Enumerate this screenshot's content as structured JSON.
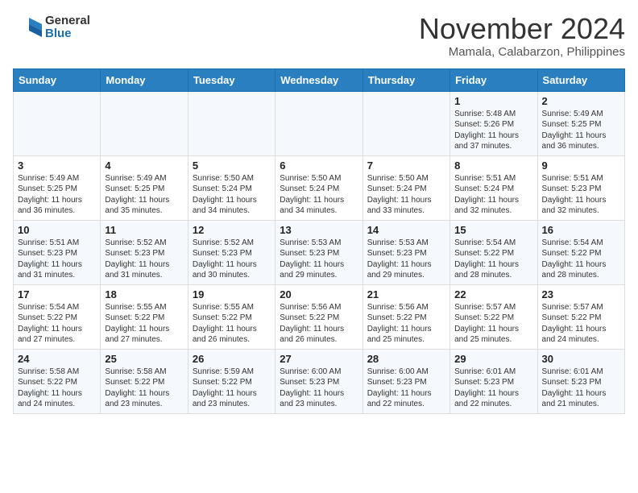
{
  "header": {
    "logo_general": "General",
    "logo_blue": "Blue",
    "month_title": "November 2024",
    "location": "Mamala, Calabarzon, Philippines"
  },
  "calendar": {
    "columns": [
      "Sunday",
      "Monday",
      "Tuesday",
      "Wednesday",
      "Thursday",
      "Friday",
      "Saturday"
    ],
    "rows": [
      [
        {
          "day": "",
          "info": ""
        },
        {
          "day": "",
          "info": ""
        },
        {
          "day": "",
          "info": ""
        },
        {
          "day": "",
          "info": ""
        },
        {
          "day": "",
          "info": ""
        },
        {
          "day": "1",
          "info": "Sunrise: 5:48 AM\nSunset: 5:26 PM\nDaylight: 11 hours\nand 37 minutes."
        },
        {
          "day": "2",
          "info": "Sunrise: 5:49 AM\nSunset: 5:25 PM\nDaylight: 11 hours\nand 36 minutes."
        }
      ],
      [
        {
          "day": "3",
          "info": "Sunrise: 5:49 AM\nSunset: 5:25 PM\nDaylight: 11 hours\nand 36 minutes."
        },
        {
          "day": "4",
          "info": "Sunrise: 5:49 AM\nSunset: 5:25 PM\nDaylight: 11 hours\nand 35 minutes."
        },
        {
          "day": "5",
          "info": "Sunrise: 5:50 AM\nSunset: 5:24 PM\nDaylight: 11 hours\nand 34 minutes."
        },
        {
          "day": "6",
          "info": "Sunrise: 5:50 AM\nSunset: 5:24 PM\nDaylight: 11 hours\nand 34 minutes."
        },
        {
          "day": "7",
          "info": "Sunrise: 5:50 AM\nSunset: 5:24 PM\nDaylight: 11 hours\nand 33 minutes."
        },
        {
          "day": "8",
          "info": "Sunrise: 5:51 AM\nSunset: 5:24 PM\nDaylight: 11 hours\nand 32 minutes."
        },
        {
          "day": "9",
          "info": "Sunrise: 5:51 AM\nSunset: 5:23 PM\nDaylight: 11 hours\nand 32 minutes."
        }
      ],
      [
        {
          "day": "10",
          "info": "Sunrise: 5:51 AM\nSunset: 5:23 PM\nDaylight: 11 hours\nand 31 minutes."
        },
        {
          "day": "11",
          "info": "Sunrise: 5:52 AM\nSunset: 5:23 PM\nDaylight: 11 hours\nand 31 minutes."
        },
        {
          "day": "12",
          "info": "Sunrise: 5:52 AM\nSunset: 5:23 PM\nDaylight: 11 hours\nand 30 minutes."
        },
        {
          "day": "13",
          "info": "Sunrise: 5:53 AM\nSunset: 5:23 PM\nDaylight: 11 hours\nand 29 minutes."
        },
        {
          "day": "14",
          "info": "Sunrise: 5:53 AM\nSunset: 5:23 PM\nDaylight: 11 hours\nand 29 minutes."
        },
        {
          "day": "15",
          "info": "Sunrise: 5:54 AM\nSunset: 5:22 PM\nDaylight: 11 hours\nand 28 minutes."
        },
        {
          "day": "16",
          "info": "Sunrise: 5:54 AM\nSunset: 5:22 PM\nDaylight: 11 hours\nand 28 minutes."
        }
      ],
      [
        {
          "day": "17",
          "info": "Sunrise: 5:54 AM\nSunset: 5:22 PM\nDaylight: 11 hours\nand 27 minutes."
        },
        {
          "day": "18",
          "info": "Sunrise: 5:55 AM\nSunset: 5:22 PM\nDaylight: 11 hours\nand 27 minutes."
        },
        {
          "day": "19",
          "info": "Sunrise: 5:55 AM\nSunset: 5:22 PM\nDaylight: 11 hours\nand 26 minutes."
        },
        {
          "day": "20",
          "info": "Sunrise: 5:56 AM\nSunset: 5:22 PM\nDaylight: 11 hours\nand 26 minutes."
        },
        {
          "day": "21",
          "info": "Sunrise: 5:56 AM\nSunset: 5:22 PM\nDaylight: 11 hours\nand 25 minutes."
        },
        {
          "day": "22",
          "info": "Sunrise: 5:57 AM\nSunset: 5:22 PM\nDaylight: 11 hours\nand 25 minutes."
        },
        {
          "day": "23",
          "info": "Sunrise: 5:57 AM\nSunset: 5:22 PM\nDaylight: 11 hours\nand 24 minutes."
        }
      ],
      [
        {
          "day": "24",
          "info": "Sunrise: 5:58 AM\nSunset: 5:22 PM\nDaylight: 11 hours\nand 24 minutes."
        },
        {
          "day": "25",
          "info": "Sunrise: 5:58 AM\nSunset: 5:22 PM\nDaylight: 11 hours\nand 23 minutes."
        },
        {
          "day": "26",
          "info": "Sunrise: 5:59 AM\nSunset: 5:22 PM\nDaylight: 11 hours\nand 23 minutes."
        },
        {
          "day": "27",
          "info": "Sunrise: 6:00 AM\nSunset: 5:23 PM\nDaylight: 11 hours\nand 23 minutes."
        },
        {
          "day": "28",
          "info": "Sunrise: 6:00 AM\nSunset: 5:23 PM\nDaylight: 11 hours\nand 22 minutes."
        },
        {
          "day": "29",
          "info": "Sunrise: 6:01 AM\nSunset: 5:23 PM\nDaylight: 11 hours\nand 22 minutes."
        },
        {
          "day": "30",
          "info": "Sunrise: 6:01 AM\nSunset: 5:23 PM\nDaylight: 11 hours\nand 21 minutes."
        }
      ]
    ]
  }
}
